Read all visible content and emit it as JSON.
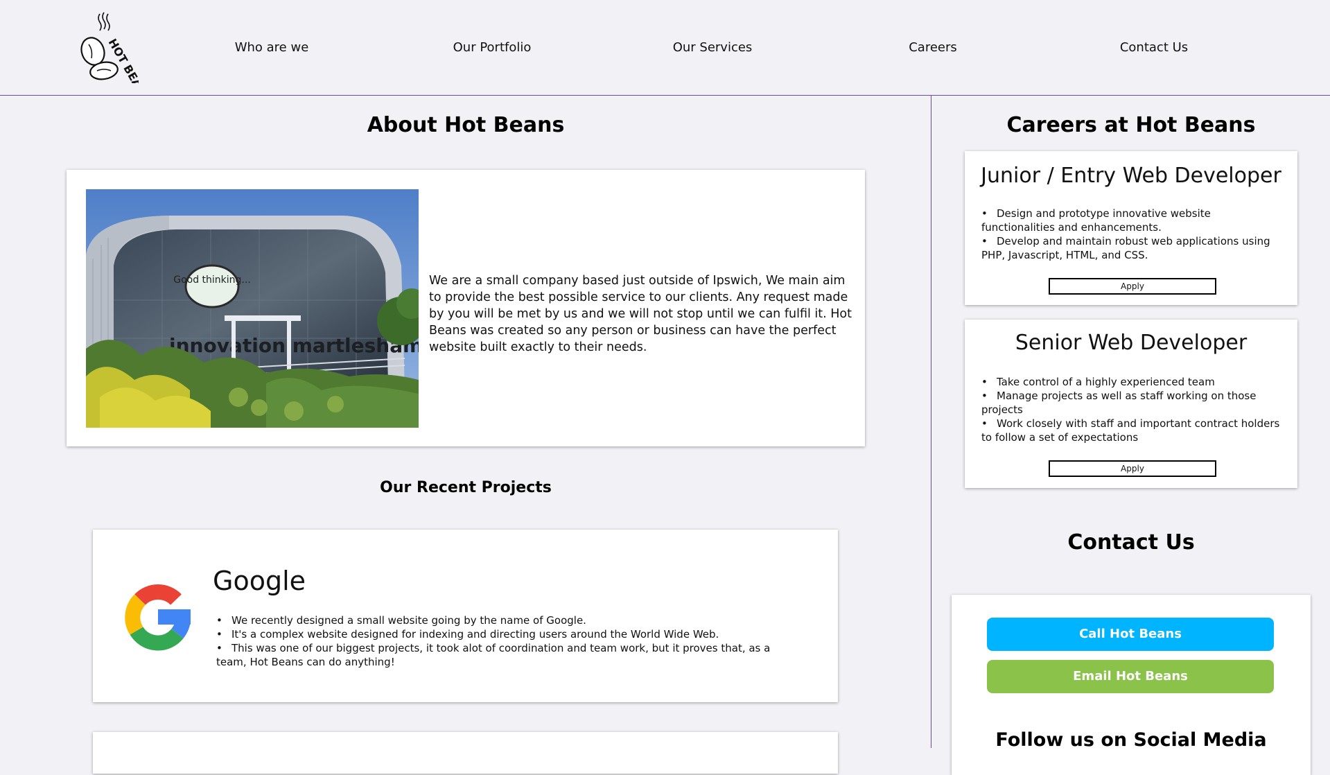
{
  "header": {
    "logo_text": "HOT BEANS",
    "nav": [
      "Who are we",
      "Our Portfolio",
      "Our Services",
      "Careers",
      "Contact Us"
    ]
  },
  "about": {
    "title": "About Hot Beans",
    "photo_sign": "Good thinking...",
    "photo_lettering": "innovation martlesham",
    "text": "We are a small company based just outside of Ipswich, We main aim to provide the best possible service to our clients. Any request made by you will be met by us and we will not stop until we can fulfil it. Hot Beans was created so any person or business can have the perfect website built exactly to their needs."
  },
  "projects": {
    "title": "Our Recent Projects",
    "items": [
      {
        "name": "Google",
        "bullets": [
          "We recently designed a small website going by the name of Google.",
          "It's a complex website designed for indexing and directing users around the World Wide Web.",
          "This was one of our biggest projects, it took alot of coordination and team work, but it proves that, as a team, Hot Beans can do anything!"
        ]
      }
    ]
  },
  "careers": {
    "title": "Careers at Hot Beans",
    "jobs": [
      {
        "title": "Junior / Entry Web Developer",
        "bullets": [
          "Design and prototype innovative website functionalities and enhancements.",
          "Develop and maintain robust web applications using PHP, Javascript, HTML, and CSS."
        ],
        "apply_label": "Apply"
      },
      {
        "title": "Senior Web Developer",
        "bullets": [
          "Take control of a highly experienced team",
          "Manage projects as well as staff working on those projects",
          "Work closely with staff and important contract holders to follow a set of expectations"
        ],
        "apply_label": "Apply"
      }
    ]
  },
  "contact": {
    "title": "Contact Us",
    "call_label": "Call Hot Beans",
    "email_label": "Email Hot Beans",
    "social_title": "Follow us on Social Media"
  },
  "colors": {
    "page_bg": "#f2f1f6",
    "divider": "#6b4aa0",
    "call_button": "#00b4ff",
    "email_button": "#8bc34a",
    "google_blue": "#4285f4",
    "google_red": "#ea4335",
    "google_yellow": "#fbbc05",
    "google_green": "#34a853"
  }
}
